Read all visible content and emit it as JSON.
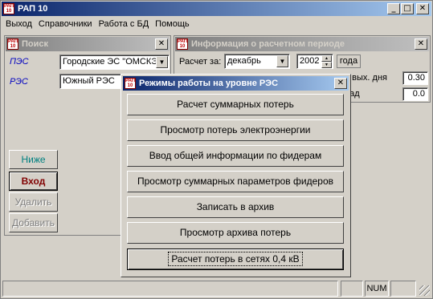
{
  "app": {
    "title": "РАП 10",
    "icon_text": "РАП 10",
    "caption_buttons": {
      "minimize": "_",
      "maximize": "□",
      "close": "✕"
    }
  },
  "menu": [
    "Выход",
    "Справочники",
    "Работа с БД",
    "Помощь"
  ],
  "search_panel": {
    "title": "Поиск",
    "pes_label": "ПЭС",
    "pes_value": "Городские ЭС \"ОМСКЭ",
    "res_label": "РЭС",
    "res_value": "Южный РЭС",
    "buttons": {
      "down": "Ниже",
      "enter": "Вход",
      "delete": "Удалить",
      "add": "Добавить"
    }
  },
  "period_panel": {
    "title": "Информация о расчетном периоде",
    "calc_for_label": "Расчет за:",
    "month": "декабрь",
    "year": "2002",
    "year_suffix": "года",
    "holiday_label": "е вых. дня",
    "holiday_value": "0.30",
    "deg_label": "рад",
    "deg_value": "0.0"
  },
  "modes_dialog": {
    "title": "Режимы работы на уровне РЭС",
    "buttons": [
      "Расчет суммарных потерь",
      "Просмотр потерь электроэнергии",
      "Ввод общей информации по фидерам",
      "Просмотр суммарных параметров фидеров",
      "Записать в архив",
      "Просмотр архива потерь",
      "Расчет потерь в сетях 0,4 кВ"
    ]
  },
  "statusbar": {
    "num": "NUM"
  },
  "colors": {
    "title_active": "#0a246a",
    "title_inactive": "#808080",
    "face": "#d4d0c8",
    "label_blue": "#0000c0",
    "enter_text": "#800000",
    "down_text": "#008080"
  }
}
